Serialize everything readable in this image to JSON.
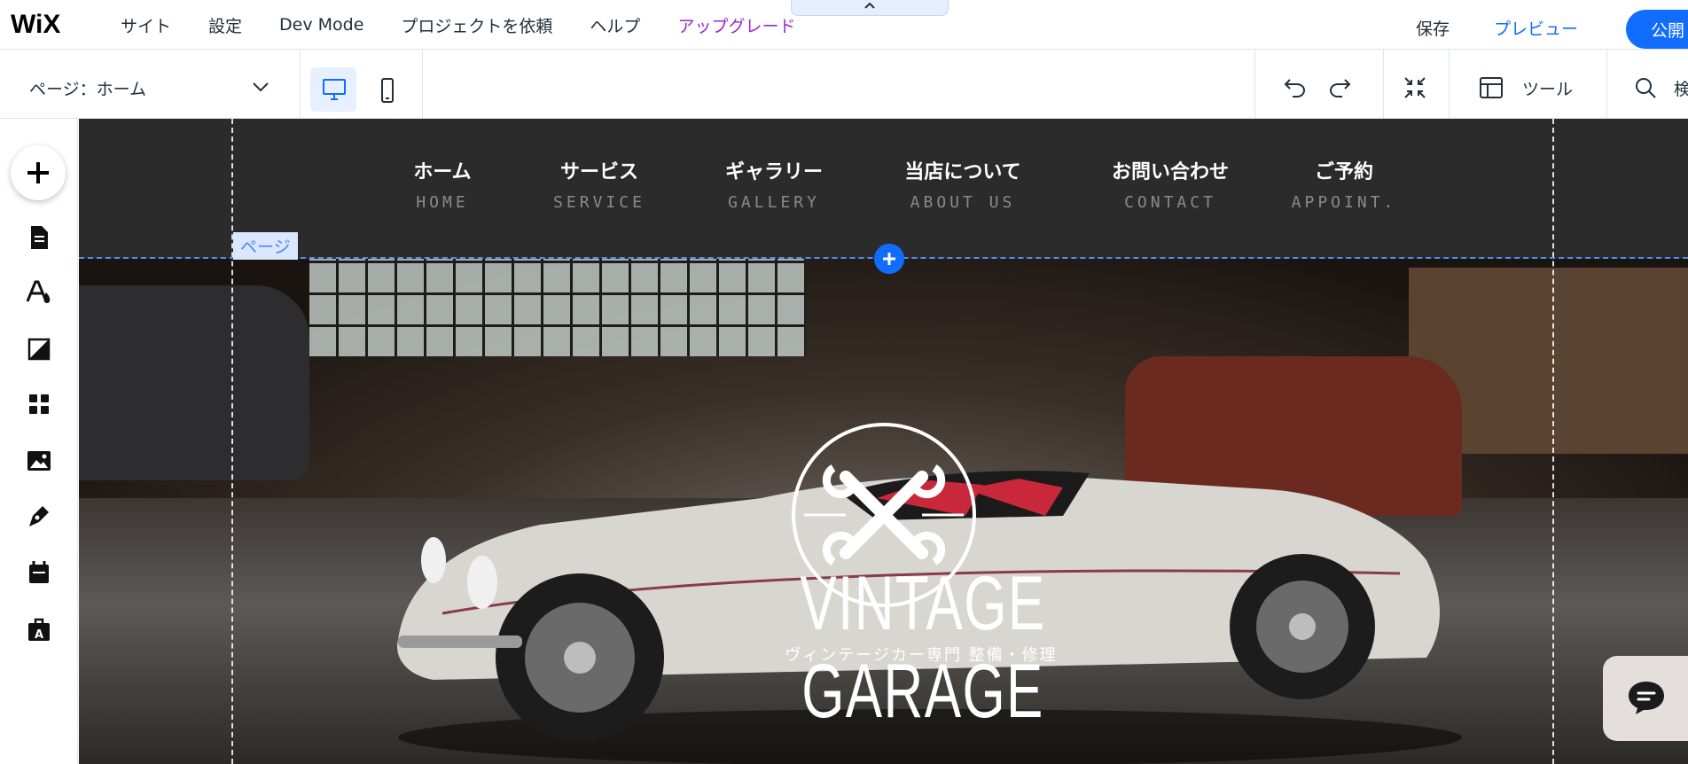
{
  "topbar": {
    "logo": "WiX",
    "menu": [
      "サイト",
      "設定",
      "Dev Mode",
      "プロジェクトを依頼",
      "ヘルプ",
      "アップグレード"
    ],
    "save": "保存",
    "preview": "プレビュー",
    "publish": "公開"
  },
  "toolbar": {
    "page_select": "ページ：ホーム",
    "tools": "ツール",
    "search": "検"
  },
  "site": {
    "nav": [
      {
        "jp": "ホーム",
        "en": "HOME"
      },
      {
        "jp": "サービス",
        "en": "SERVICE"
      },
      {
        "jp": "ギャラリー",
        "en": "GALLERY"
      },
      {
        "jp": "当店について",
        "en": "ABOUT US"
      },
      {
        "jp": "お問い合わせ",
        "en": "CONTACT"
      },
      {
        "jp": "ご予約",
        "en": "APPOINT."
      }
    ],
    "page_tag": "ページ",
    "brand": "VINTAGE GARAGE",
    "tagline": "ヴィンテージカー専門 整備・修理"
  },
  "colors": {
    "accent": "#116dff",
    "upgrade": "#9a27d5",
    "header_bg": "#2b2b2b"
  }
}
